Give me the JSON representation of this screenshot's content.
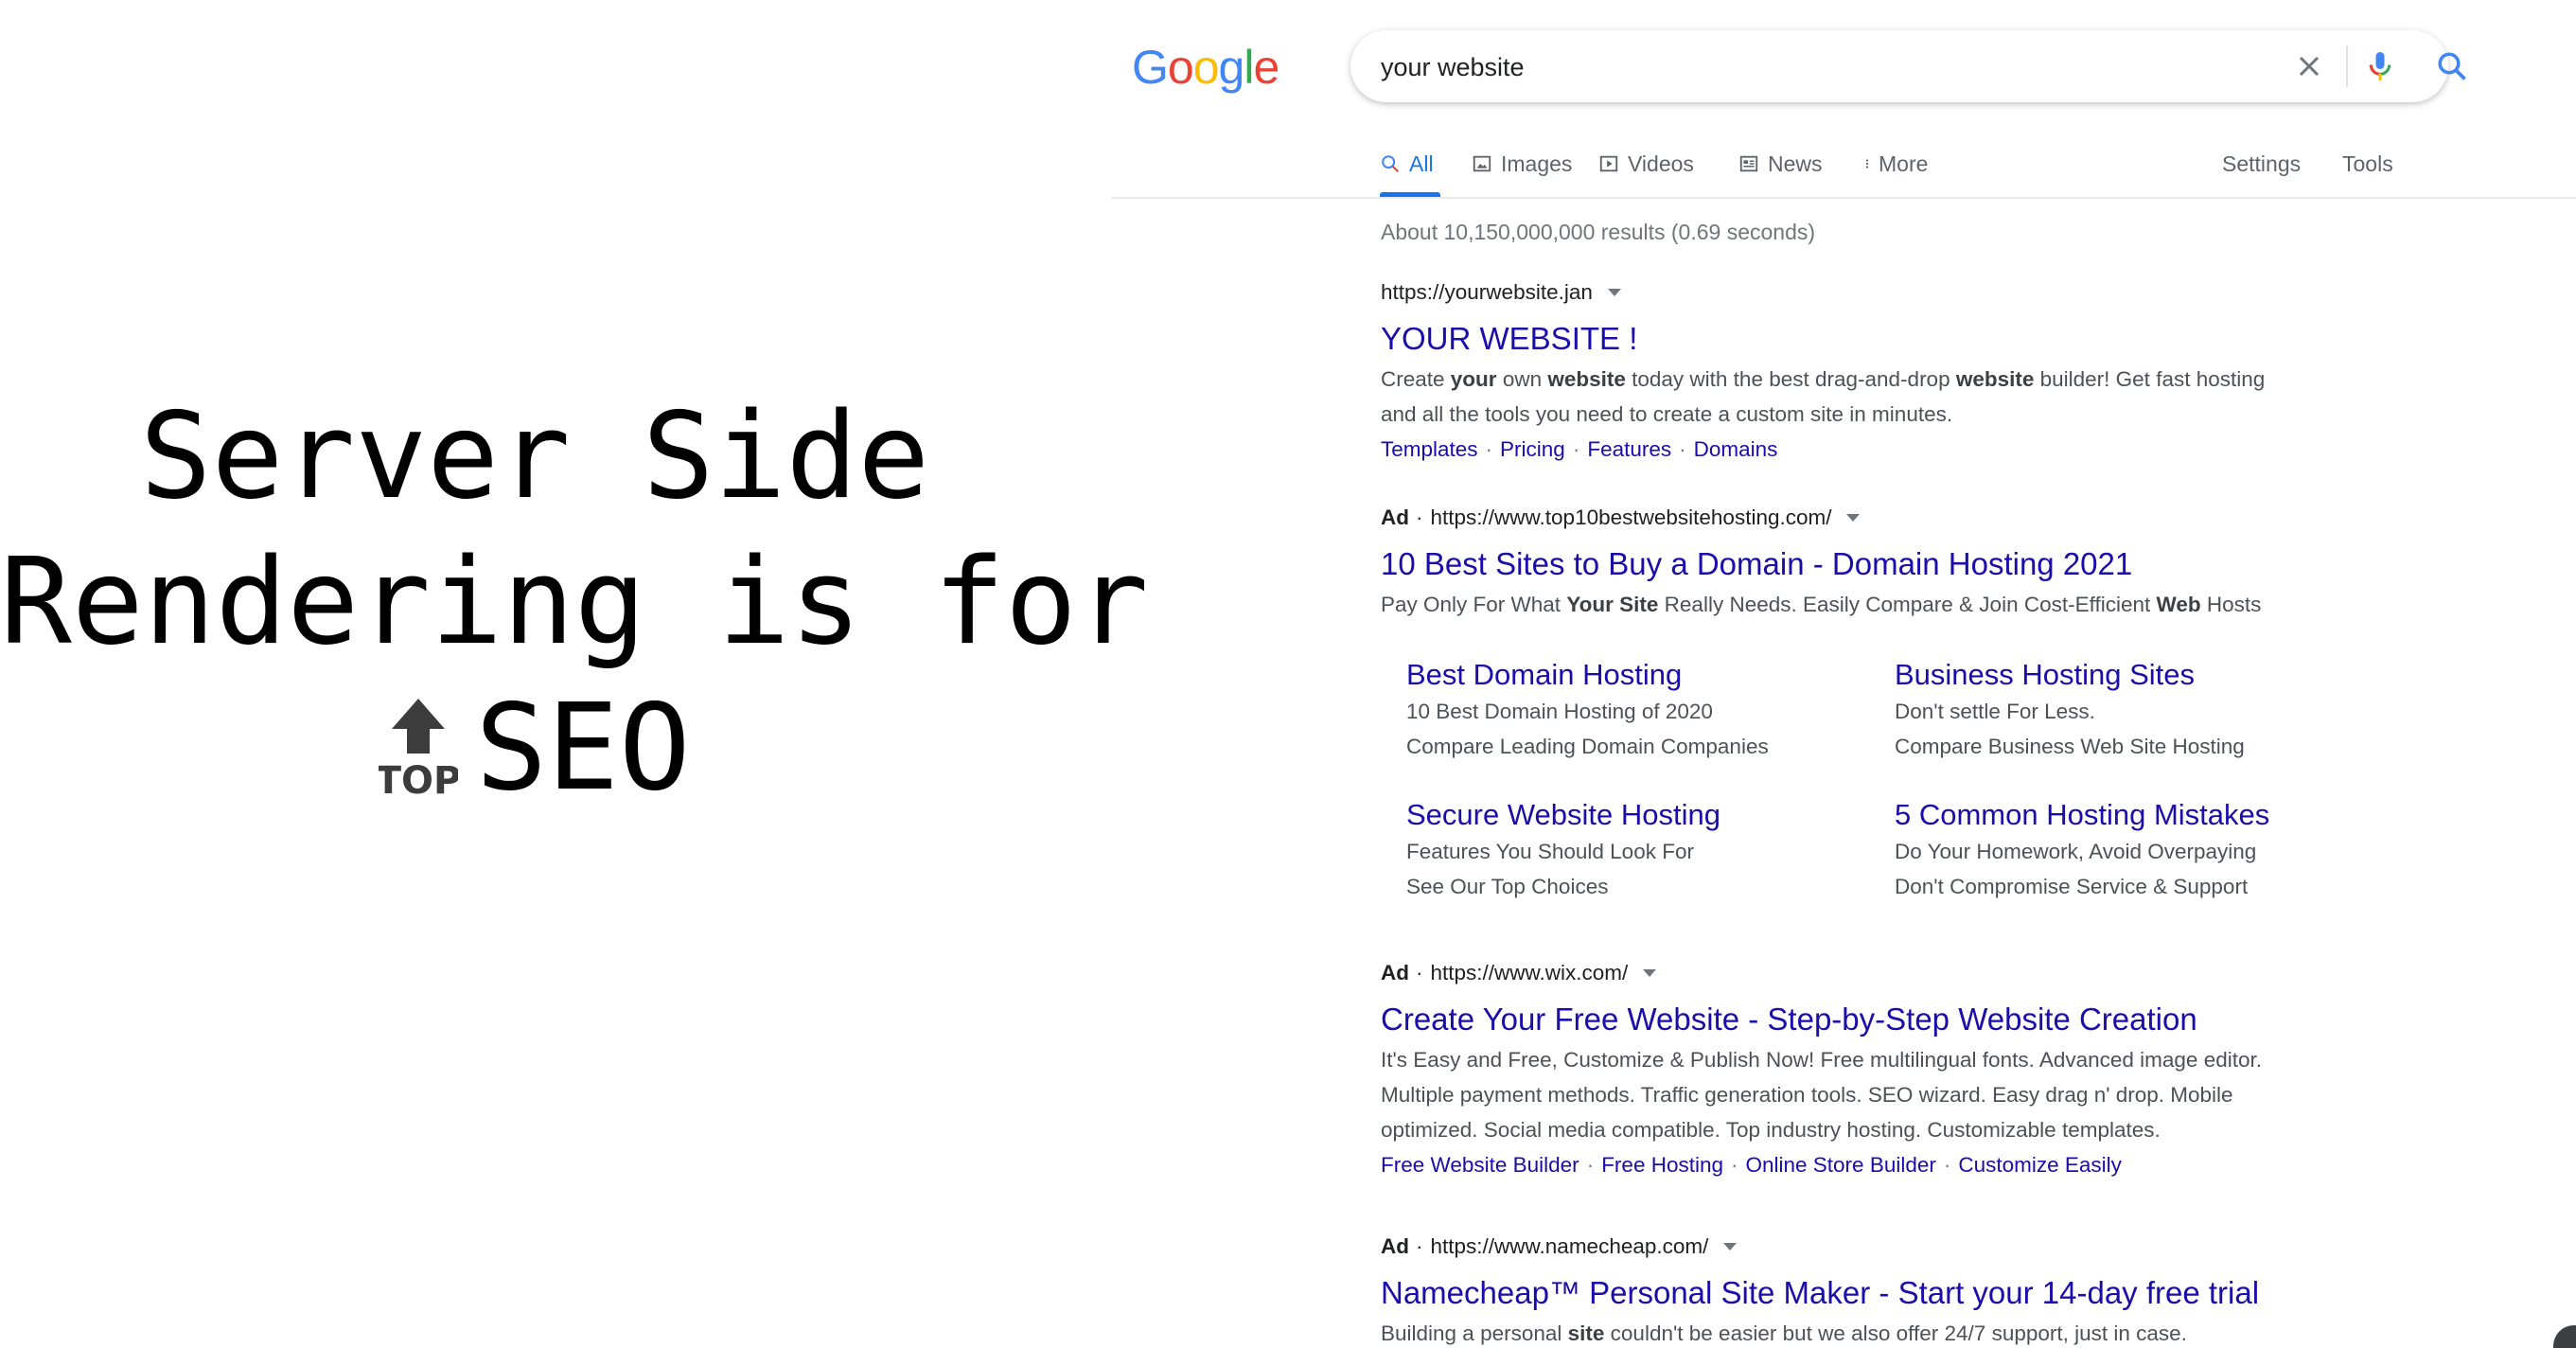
{
  "slide": {
    "line1": "Server Side",
    "line2": "Rendering is for",
    "emoji_label": "TOP",
    "seo": "SEO"
  },
  "google": {
    "logo_letters": [
      {
        "ch": "G",
        "color": "#4285F4"
      },
      {
        "ch": "o",
        "color": "#EA4335"
      },
      {
        "ch": "o",
        "color": "#FBBC05"
      },
      {
        "ch": "g",
        "color": "#4285F4"
      },
      {
        "ch": "l",
        "color": "#34A853"
      },
      {
        "ch": "e",
        "color": "#EA4335"
      }
    ],
    "search": {
      "value": "your website"
    },
    "tabs": [
      {
        "label": "All",
        "icon": "search-icon"
      },
      {
        "label": "Images",
        "icon": "image-icon"
      },
      {
        "label": "Videos",
        "icon": "video-icon"
      },
      {
        "label": "News",
        "icon": "news-icon"
      },
      {
        "label": "More",
        "icon": "more-icon"
      },
      {
        "label": "Settings"
      },
      {
        "label": "Tools"
      }
    ],
    "stats": "About 10,150,000,000 results (0.69 seconds)",
    "results": [
      {
        "url": "https://yourwebsite.jan",
        "title": "YOUR WEBSITE !",
        "snippet_line1": [
          "Create ",
          "your",
          " own ",
          "website",
          " today with the best drag-and-drop ",
          "website",
          " builder! Get fast hosting"
        ],
        "snippet_line2": "and all the tools you need to create a custom site in minutes.",
        "sitelinks": [
          "Templates",
          "Pricing",
          "Features",
          "Domains"
        ]
      },
      {
        "ad": "Ad",
        "url": "https://www.top10bestwebsitehosting.com/",
        "title": "10 Best Sites to Buy a Domain - Domain Hosting 2021",
        "snippet_line1": [
          "Pay Only For What ",
          "Your Site",
          " Really Needs. Easily Compare & Join Cost-Efficient ",
          "Web",
          " Hosts"
        ],
        "sitelinks_grid": [
          {
            "title": "Best Domain Hosting",
            "desc1": "10 Best Domain Hosting of 2020",
            "desc2": "Compare Leading Domain Companies"
          },
          {
            "title": "Business Hosting Sites",
            "desc1": "Don't settle For Less.",
            "desc2": "Compare Business Web Site Hosting"
          },
          {
            "title": "Secure Website Hosting",
            "desc1": "Features You Should Look For",
            "desc2": "See Our Top Choices"
          },
          {
            "title": "5 Common Hosting Mistakes",
            "desc1": "Do Your Homework, Avoid Overpaying",
            "desc2": "Don't Compromise Service & Support"
          }
        ]
      },
      {
        "ad": "Ad",
        "url": "https://www.wix.com/",
        "title": "Create Your Free Website - Step-by-Step Website Creation",
        "snippet_line1": "It's Easy and Free, Customize & Publish Now! Free multilingual fonts. Advanced image editor.",
        "snippet_line2": "Multiple payment methods. Traffic generation tools. SEO wizard. Easy drag n' drop. Mobile",
        "snippet_line3": "optimized. Social media compatible. Top industry hosting. Customizable templates.",
        "sitelinks": [
          "Free Website Builder",
          "Free Hosting",
          "Online Store Builder",
          "Customize Easily"
        ]
      },
      {
        "ad": "Ad",
        "url": "https://www.namecheap.com/",
        "title": "Namecheap™ Personal Site Maker - Start your 14-day free trial",
        "snippet_line1": [
          "Building a personal ",
          "site",
          " couldn't be easier but we also offer 24/7 support, just in case."
        ]
      }
    ]
  }
}
